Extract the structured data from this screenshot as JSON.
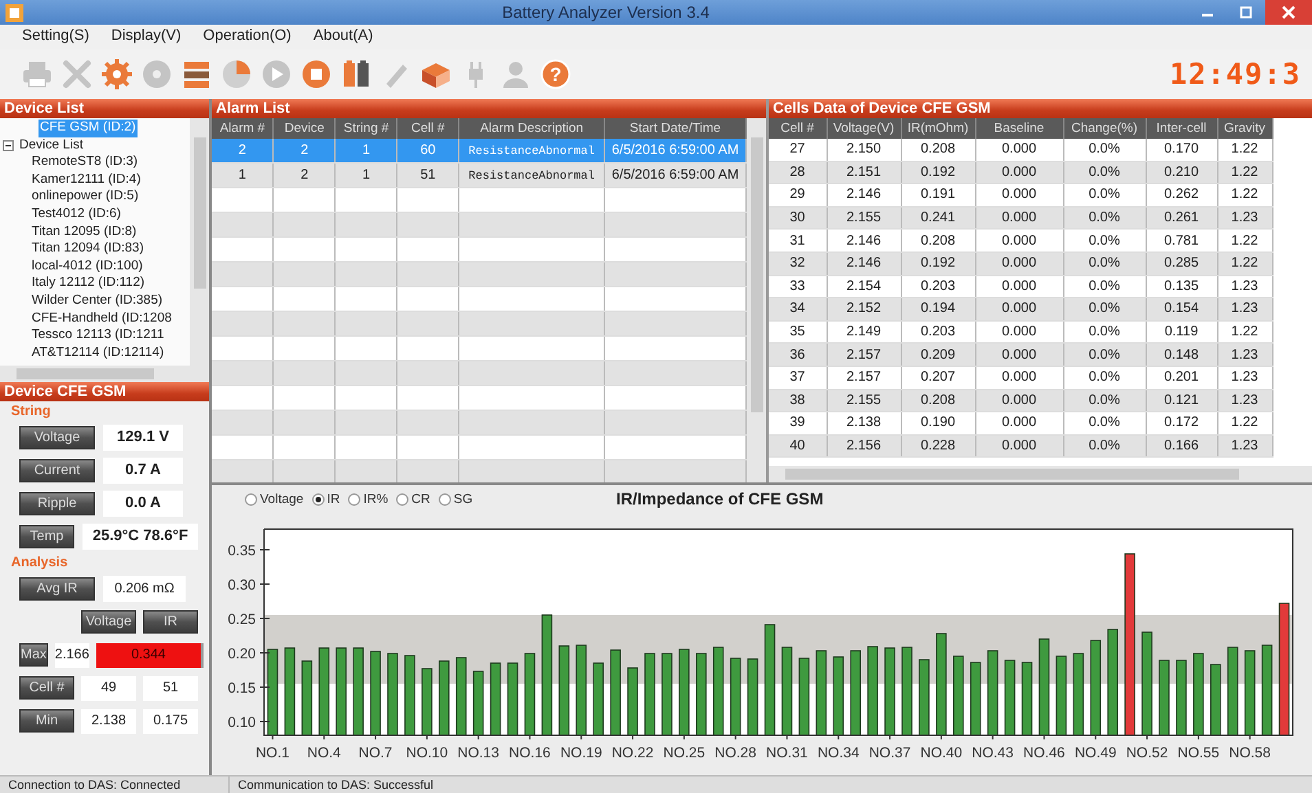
{
  "window": {
    "title": "Battery Analyzer Version 3.4"
  },
  "menu": [
    "Setting(S)",
    "Display(V)",
    "Operation(O)",
    "About(A)"
  ],
  "toolbar": [
    {
      "kind": "printer",
      "disabled": true
    },
    {
      "kind": "tools",
      "disabled": true
    },
    {
      "kind": "gear",
      "disabled": false
    },
    {
      "kind": "disc",
      "disabled": true
    },
    {
      "kind": "list",
      "disabled": false
    },
    {
      "kind": "pie",
      "disabled": false
    },
    {
      "kind": "play",
      "disabled": true
    },
    {
      "kind": "stop",
      "disabled": false
    },
    {
      "kind": "battery",
      "disabled": false
    },
    {
      "kind": "pencil",
      "disabled": true
    },
    {
      "kind": "box",
      "disabled": false
    },
    {
      "kind": "plug",
      "disabled": true
    },
    {
      "kind": "person",
      "disabled": true
    },
    {
      "kind": "help",
      "disabled": false,
      "glyph": "?"
    }
  ],
  "clock": "12:49:3",
  "device_list": {
    "title": "Device List",
    "items": [
      {
        "label": "CFE GSM (ID:2)",
        "selected": true
      },
      {
        "label": "Device List",
        "selected": false,
        "expanded": true,
        "children": [
          {
            "label": "RemoteST8 (ID:3)",
            "selected": false
          },
          {
            "label": "Kamer12111 (ID:4)",
            "selected": false
          },
          {
            "label": "onlinepower (ID:5)",
            "selected": false
          },
          {
            "label": "Test4012 (ID:6)",
            "selected": false
          },
          {
            "label": "Titan 12095 (ID:8)",
            "selected": false
          },
          {
            "label": "Titan 12094 (ID:83)",
            "selected": false
          },
          {
            "label": "local-4012 (ID:100)",
            "selected": false
          },
          {
            "label": "Italy 12112 (ID:112)",
            "selected": false
          },
          {
            "label": "Wilder Center (ID:385)",
            "selected": false
          },
          {
            "label": "CFE-Handheld (ID:1208",
            "selected": false
          },
          {
            "label": "Tessco 12113 (ID:1211",
            "selected": false
          },
          {
            "label": "AT&T12114 (ID:12114)",
            "selected": false
          }
        ]
      }
    ]
  },
  "device_panel": {
    "title": "Device CFE GSM",
    "string": {
      "title": "String",
      "fields": [
        {
          "label": "Voltage",
          "value": "129.1 V"
        },
        {
          "label": "Current",
          "value": "0.7 A"
        },
        {
          "label": "Ripple",
          "value": "0.0 A"
        },
        {
          "label": "Temp",
          "value": "25.9°C 78.6°F"
        }
      ]
    },
    "analysis": {
      "title": "Analysis",
      "avg": {
        "label": "Avg IR",
        "value": "0.206 mΩ"
      },
      "columns": [
        "Voltage",
        "IR"
      ],
      "rows": [
        {
          "label": "Max",
          "cells": [
            {
              "text": "2.166",
              "alarm": false
            },
            {
              "text": "0.344",
              "alarm": true
            }
          ]
        },
        {
          "label": "Cell #",
          "cells": [
            {
              "text": "49",
              "alarm": false
            },
            {
              "text": "51",
              "alarm": false
            }
          ]
        },
        {
          "label": "Min",
          "cells": [
            {
              "text": "2.138",
              "alarm": false
            },
            {
              "text": "0.175",
              "alarm": false
            }
          ]
        }
      ]
    }
  },
  "alarm_list": {
    "title": "Alarm List",
    "columns": [
      "Alarm #",
      "Device",
      "String #",
      "Cell #",
      "Alarm Description",
      "Start Date/Time"
    ],
    "rows": [
      {
        "cells": [
          "2",
          "2",
          "1",
          "60",
          "ResistanceAbnormal",
          "6/5/2016 6:59:00 AM"
        ],
        "selected": true
      },
      {
        "cells": [
          "1",
          "2",
          "1",
          "51",
          "ResistanceAbnormal",
          "6/5/2016 6:59:00 AM"
        ],
        "selected": false
      }
    ]
  },
  "cells_table": {
    "title": "Cells Data of Device CFE GSM",
    "columns": [
      "Cell #",
      "Voltage(V)",
      "IR(mOhm)",
      "Baseline",
      "Change(%)",
      "Inter-cell",
      "Gravity"
    ],
    "rows": [
      [
        "27",
        "2.150",
        "0.208",
        "0.000",
        "0.0%",
        "0.170",
        "1.22"
      ],
      [
        "28",
        "2.151",
        "0.192",
        "0.000",
        "0.0%",
        "0.210",
        "1.22"
      ],
      [
        "29",
        "2.146",
        "0.191",
        "0.000",
        "0.0%",
        "0.262",
        "1.22"
      ],
      [
        "30",
        "2.155",
        "0.241",
        "0.000",
        "0.0%",
        "0.261",
        "1.23"
      ],
      [
        "31",
        "2.146",
        "0.208",
        "0.000",
        "0.0%",
        "0.781",
        "1.22"
      ],
      [
        "32",
        "2.146",
        "0.192",
        "0.000",
        "0.0%",
        "0.285",
        "1.22"
      ],
      [
        "33",
        "2.154",
        "0.203",
        "0.000",
        "0.0%",
        "0.135",
        "1.23"
      ],
      [
        "34",
        "2.152",
        "0.194",
        "0.000",
        "0.0%",
        "0.154",
        "1.23"
      ],
      [
        "35",
        "2.149",
        "0.203",
        "0.000",
        "0.0%",
        "0.119",
        "1.22"
      ],
      [
        "36",
        "2.157",
        "0.209",
        "0.000",
        "0.0%",
        "0.148",
        "1.23"
      ],
      [
        "37",
        "2.157",
        "0.207",
        "0.000",
        "0.0%",
        "0.201",
        "1.23"
      ],
      [
        "38",
        "2.155",
        "0.208",
        "0.000",
        "0.0%",
        "0.121",
        "1.23"
      ],
      [
        "39",
        "2.138",
        "0.190",
        "0.000",
        "0.0%",
        "0.172",
        "1.22"
      ],
      [
        "40",
        "2.156",
        "0.228",
        "0.000",
        "0.0%",
        "0.166",
        "1.23"
      ]
    ]
  },
  "chart_panel": {
    "options": [
      {
        "label": "Voltage",
        "selected": false
      },
      {
        "label": "IR",
        "selected": true
      },
      {
        "label": "IR%",
        "selected": false
      },
      {
        "label": "CR",
        "selected": false
      },
      {
        "label": "SG",
        "selected": false
      }
    ],
    "chart_data": {
      "type": "bar",
      "title": "IR/Impedance of CFE GSM",
      "categories": [
        "NO.1",
        null,
        null,
        "NO.4",
        null,
        null,
        "NO.7",
        null,
        null,
        "NO.10",
        null,
        null,
        "NO.13",
        null,
        null,
        "NO.16",
        null,
        null,
        "NO.19",
        null,
        null,
        "NO.22",
        null,
        null,
        "NO.25",
        null,
        null,
        "NO.28",
        null,
        null,
        "NO.31",
        null,
        null,
        "NO.34",
        null,
        null,
        "NO.37",
        null,
        null,
        "NO.40",
        null,
        null,
        "NO.43",
        null,
        null,
        "NO.46",
        null,
        null,
        "NO.49",
        null,
        null,
        "NO.52",
        null,
        null,
        "NO.55",
        null,
        null,
        "NO.58",
        null,
        null
      ],
      "series": [
        {
          "color": "#3f9a3f",
          "values": [
            0.205,
            0.207,
            0.188,
            0.207,
            0.207,
            0.207,
            0.202,
            0.199,
            0.196,
            0.177,
            0.188,
            0.193,
            0.173,
            0.185,
            0.185,
            0.199,
            0.255,
            0.21,
            0.211,
            0.185,
            0.204,
            0.178,
            0.199,
            0.199,
            0.205,
            0.199,
            0.208,
            0.192,
            0.191,
            0.241,
            0.208,
            0.192,
            0.203,
            0.194,
            0.203,
            0.209,
            0.207,
            0.208,
            0.19,
            0.228,
            0.195,
            0.186,
            0.203,
            0.189,
            0.186,
            0.22,
            0.195,
            0.199,
            0.218,
            0.234,
            null,
            0.23,
            0.189,
            0.189,
            0.199,
            0.183,
            0.208,
            0.203,
            0.211,
            null
          ]
        },
        {
          "color": "#e23a3a",
          "values": [
            null,
            null,
            null,
            null,
            null,
            null,
            null,
            null,
            null,
            null,
            null,
            null,
            null,
            null,
            null,
            null,
            null,
            null,
            null,
            null,
            null,
            null,
            null,
            null,
            null,
            null,
            null,
            null,
            null,
            null,
            null,
            null,
            null,
            null,
            null,
            null,
            null,
            null,
            null,
            null,
            null,
            null,
            null,
            null,
            null,
            null,
            null,
            null,
            null,
            null,
            0.344,
            null,
            null,
            null,
            null,
            null,
            null,
            null,
            null,
            0.272
          ]
        }
      ],
      "ylim": [
        0.08,
        0.38
      ],
      "yticks": [
        {
          "value": 0.1,
          "label": "0.10"
        },
        {
          "value": 0.15,
          "label": "0.15"
        },
        {
          "value": 0.2,
          "label": "0.20"
        },
        {
          "value": 0.25,
          "label": "0.25"
        },
        {
          "value": 0.3,
          "label": "0.30"
        },
        {
          "value": 0.35,
          "label": "0.35"
        }
      ],
      "bands": [
        {
          "axis": "y",
          "from": 0.155,
          "to": 0.255
        }
      ]
    }
  },
  "status_bar": [
    "Connection to DAS:  Connected",
    "Communication to DAS:  Successful"
  ]
}
